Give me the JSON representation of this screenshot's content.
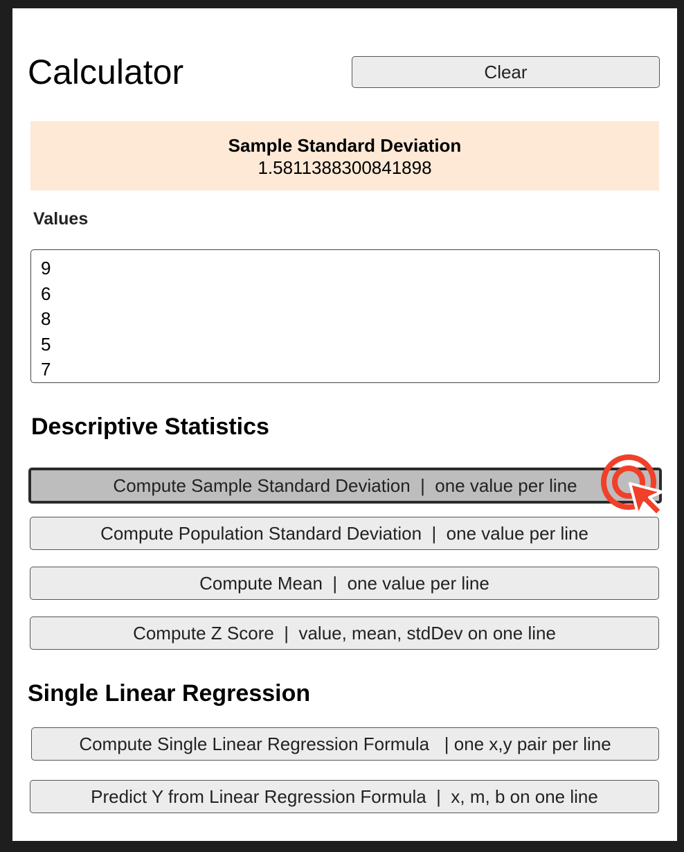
{
  "app": {
    "title": "Calculator",
    "clear_label": "Clear"
  },
  "result": {
    "label": "Sample Standard Deviation",
    "value": "1.5811388300841898"
  },
  "values": {
    "label": "Values",
    "text": "9\n6\n8\n5\n7"
  },
  "descriptive": {
    "title": "Descriptive Statistics",
    "buttons": [
      "Compute Sample Standard Deviation  |  one value per line",
      "Compute Population Standard Deviation  |  one value per line",
      "Compute Mean  |  one value per line",
      "Compute Z Score  |  value, mean, stdDev on one line"
    ]
  },
  "regression": {
    "title": "Single Linear Regression",
    "buttons": [
      "Compute Single Linear Regression Formula   | one x,y pair per line",
      "Predict Y from Linear Regression Formula  |  x, m, b on one line"
    ]
  },
  "colors": {
    "result_bg": "#fde9d6",
    "button_bg": "#ececec",
    "active_button_bg": "#bdbdbd",
    "cursor": "#f0402a"
  }
}
